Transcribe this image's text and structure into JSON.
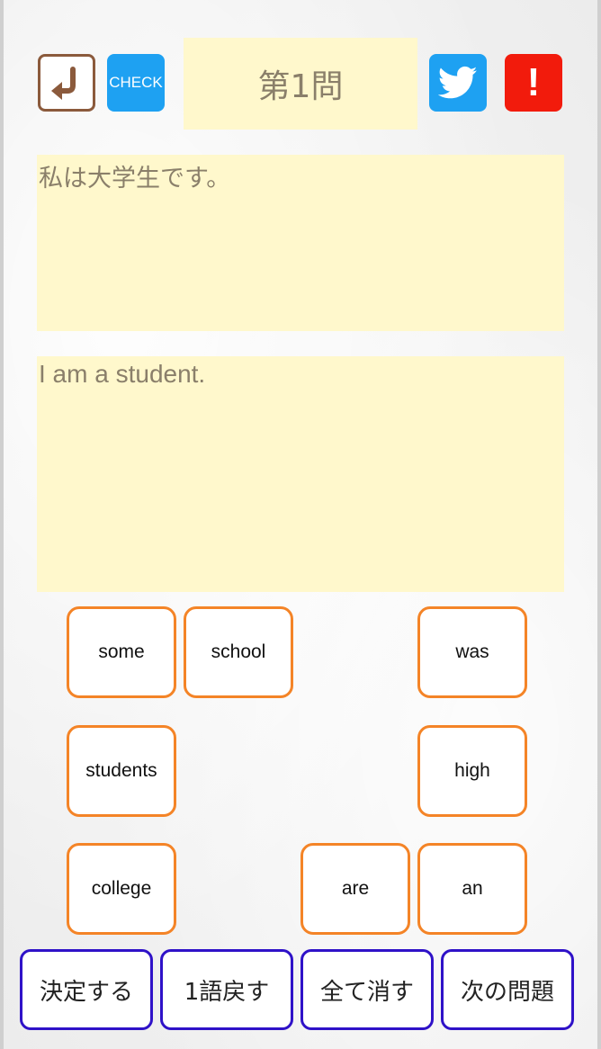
{
  "header": {
    "check_label": "CHECK",
    "question_title": "第1問",
    "alert_label": "!"
  },
  "prompt": {
    "japanese": "私は大学生です。",
    "answer": "I am a student."
  },
  "words": [
    {
      "label": "some"
    },
    {
      "label": "school"
    },
    {
      "label": "was"
    },
    {
      "label": "students"
    },
    {
      "label": "high"
    },
    {
      "label": "college"
    },
    {
      "label": "are"
    },
    {
      "label": "an"
    }
  ],
  "actions": {
    "decide": "決定する",
    "undo_one": "1語戻す",
    "clear_all": "全て消す",
    "next": "次の問題"
  },
  "colors": {
    "panel_bg": "#fff8cc",
    "word_border": "#f48427",
    "action_border": "#2f12c8",
    "twitter_blue": "#1ea1f2",
    "alert_red": "#f21b0c",
    "back_brown": "#8b5a3c"
  },
  "icons": {
    "back": "return-arrow-icon",
    "twitter": "twitter-bird-icon"
  }
}
